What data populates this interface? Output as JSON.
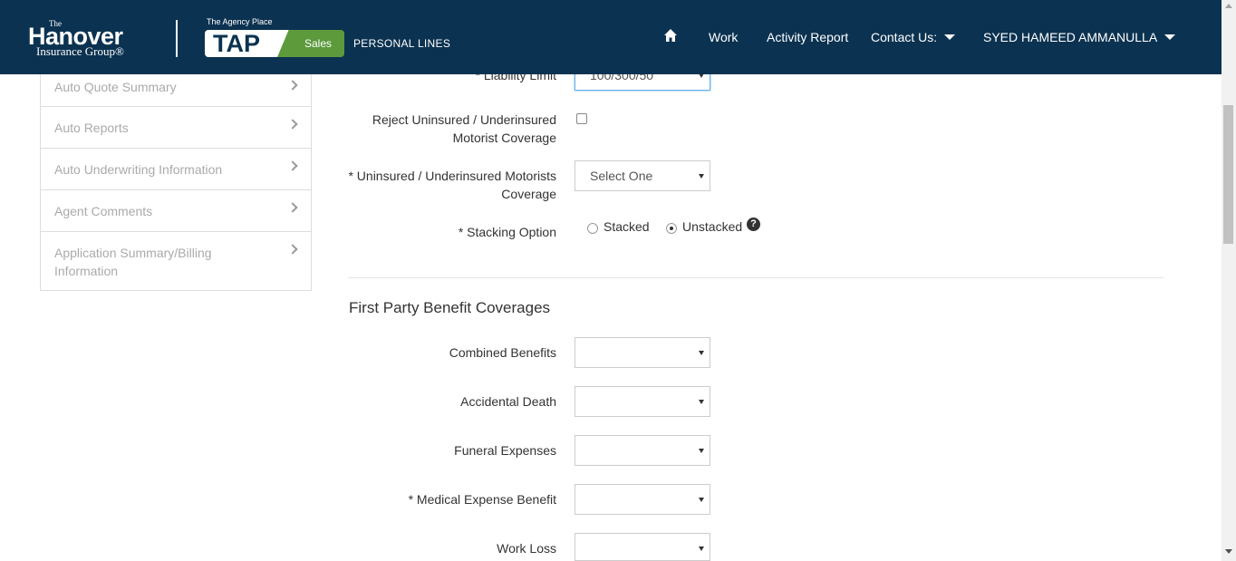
{
  "header": {
    "logo": {
      "the": "The",
      "name": "Hanover",
      "sub": "Insurance Group®"
    },
    "tap": {
      "caption": "The Agency Place",
      "mark": "TAP",
      "badge": "Sales"
    },
    "product": "PERSONAL LINES",
    "nav": {
      "home_icon": "home-icon",
      "work": "Work",
      "activity_report": "Activity Report",
      "contact_us": "Contact Us:",
      "user": "SYED HAMEED AMMANULLA"
    }
  },
  "sidebar": {
    "items": [
      {
        "label": "Auto Quote Summary"
      },
      {
        "label": "Auto Reports"
      },
      {
        "label": "Auto Underwriting Information"
      },
      {
        "label": "Agent Comments"
      },
      {
        "label": "Application Summary/Billing Information"
      }
    ]
  },
  "form": {
    "liability_limit": {
      "label": "* Liability Limit",
      "value": "100/300/50"
    },
    "reject_um": {
      "label": "Reject Uninsured / Underinsured Motorist Coverage",
      "checked": false
    },
    "um_coverage": {
      "label": "* Uninsured / Underinsured Motorists Coverage",
      "value": "Select One"
    },
    "stacking": {
      "label": "* Stacking Option",
      "options": [
        "Stacked",
        "Unstacked"
      ],
      "selected": "Unstacked"
    },
    "section_title": "First Party Benefit Coverages",
    "combined_benefits": {
      "label": "Combined Benefits",
      "value": ""
    },
    "accidental_death": {
      "label": "Accidental Death",
      "value": ""
    },
    "funeral_expenses": {
      "label": "Funeral Expenses",
      "value": ""
    },
    "medical_expense": {
      "label": "* Medical Expense Benefit",
      "value": ""
    },
    "work_loss": {
      "label": "Work Loss",
      "value": ""
    }
  },
  "colors": {
    "header_bg": "#0b3250",
    "tap_green": "#5c9a3c",
    "focus": "#66afe9"
  }
}
